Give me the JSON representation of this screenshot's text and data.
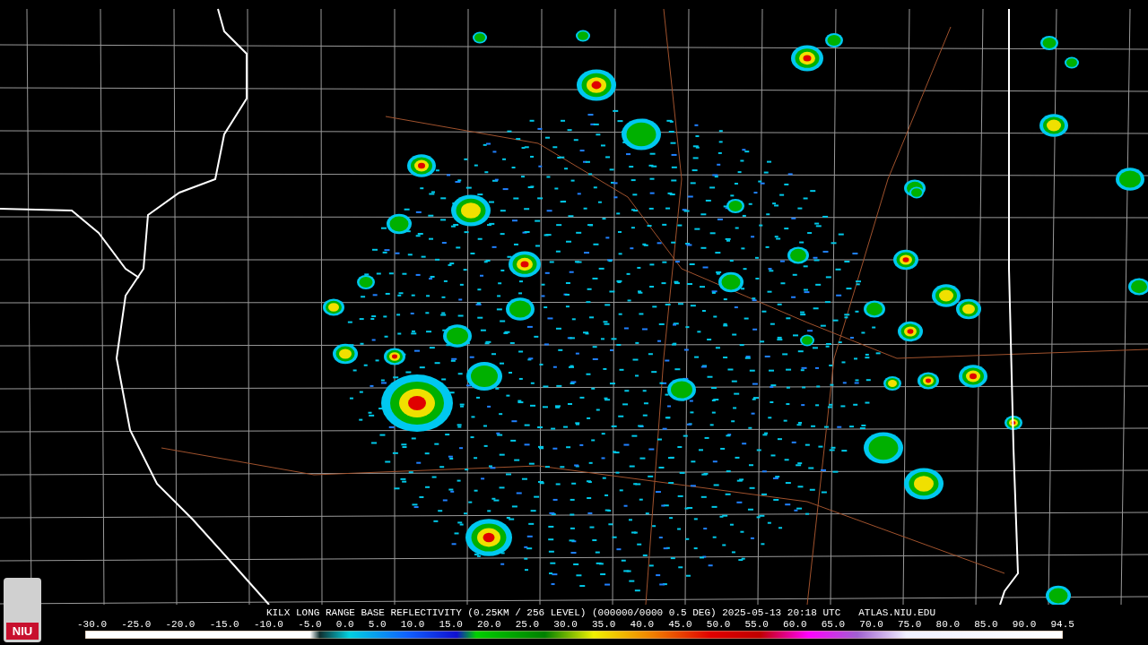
{
  "logo": {
    "text": "NIU"
  },
  "caption": {
    "title": "KILX LONG RANGE BASE REFLECTIVITY (0.25KM / 256 LEVEL) (000000/0000 0.5 DEG) 2025-05-13 20:18 UTC",
    "site": "ATLAS.NIU.EDU"
  },
  "color_scale": {
    "ticks": [
      "-30.0",
      "-25.0",
      "-20.0",
      "-15.0",
      "-10.0",
      "-5.0",
      "0.0",
      "5.0",
      "10.0",
      "15.0",
      "20.0",
      "25.0",
      "30.0",
      "35.0",
      "40.0",
      "45.0",
      "50.0",
      "55.0",
      "60.0",
      "65.0",
      "70.0",
      "75.0",
      "80.0",
      "85.0",
      "90.0",
      "94.5"
    ]
  }
}
